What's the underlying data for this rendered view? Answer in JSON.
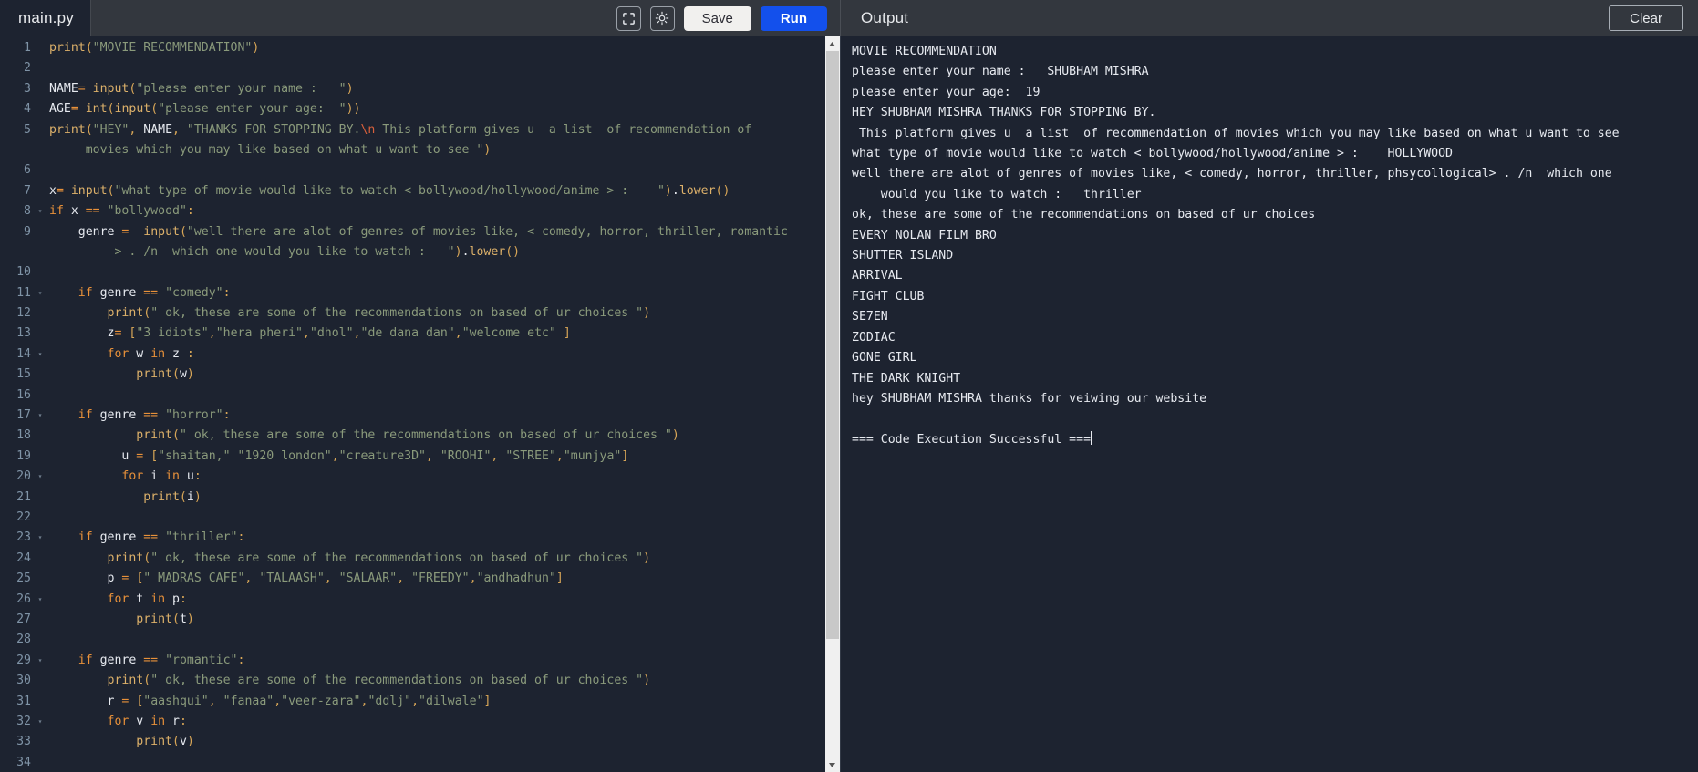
{
  "editor_toolbar": {
    "filename": "main.py",
    "fullscreen_icon": "fullscreen-icon",
    "theme_icon": "brightness-sun-icon",
    "save_label": "Save",
    "run_label": "Run",
    "save_bg": "#f1f0ee",
    "run_bg": "#1350ec"
  },
  "output_header": {
    "title": "Output",
    "clear_label": "Clear"
  },
  "editor": {
    "language": "python",
    "lines": [
      {
        "num": "1",
        "fold": "",
        "segs": [
          {
            "t": "print",
            "c": "fn"
          },
          {
            "t": "(",
            "c": "punc"
          },
          {
            "t": "\"MOVIE RECOMMENDATION\"",
            "c": "str"
          },
          {
            "t": ")",
            "c": "punc"
          }
        ]
      },
      {
        "num": "2",
        "fold": "",
        "segs": []
      },
      {
        "num": "3",
        "fold": "",
        "segs": [
          {
            "t": "NAME",
            "c": "var"
          },
          {
            "t": "= ",
            "c": "op"
          },
          {
            "t": "input",
            "c": "fn"
          },
          {
            "t": "(",
            "c": "punc"
          },
          {
            "t": "\"please enter your name :   \"",
            "c": "str"
          },
          {
            "t": ")",
            "c": "punc"
          }
        ]
      },
      {
        "num": "4",
        "fold": "",
        "segs": [
          {
            "t": "AGE",
            "c": "var"
          },
          {
            "t": "= ",
            "c": "op"
          },
          {
            "t": "int",
            "c": "fn"
          },
          {
            "t": "(",
            "c": "punc"
          },
          {
            "t": "input",
            "c": "fn"
          },
          {
            "t": "(",
            "c": "punc"
          },
          {
            "t": "\"please enter your age:  \"",
            "c": "str"
          },
          {
            "t": "))",
            "c": "punc"
          }
        ]
      },
      {
        "num": "5",
        "fold": "",
        "segs": [
          {
            "t": "print",
            "c": "fn"
          },
          {
            "t": "(",
            "c": "punc"
          },
          {
            "t": "\"HEY\"",
            "c": "str"
          },
          {
            "t": ", ",
            "c": "punc"
          },
          {
            "t": "NAME",
            "c": "var"
          },
          {
            "t": ", ",
            "c": "punc"
          },
          {
            "t": "\"THANKS FOR STOPPING BY.",
            "c": "str"
          },
          {
            "t": "\\n",
            "c": "esc"
          },
          {
            "t": " This platform gives u  a list  of recommendation of",
            "c": "str"
          }
        ]
      },
      {
        "num": "",
        "fold": "",
        "segs": [
          {
            "t": "     movies which you may like based on what u want to see \"",
            "c": "str"
          },
          {
            "t": ")",
            "c": "punc"
          }
        ]
      },
      {
        "num": "6",
        "fold": "",
        "segs": []
      },
      {
        "num": "7",
        "fold": "",
        "segs": [
          {
            "t": "x",
            "c": "var"
          },
          {
            "t": "= ",
            "c": "op"
          },
          {
            "t": "input",
            "c": "fn"
          },
          {
            "t": "(",
            "c": "punc"
          },
          {
            "t": "\"what type of movie would like to watch < bollywood/hollywood/anime > :    \"",
            "c": "str"
          },
          {
            "t": ")",
            "c": "punc"
          },
          {
            "t": ".",
            "c": "var"
          },
          {
            "t": "lower",
            "c": "fn"
          },
          {
            "t": "()",
            "c": "punc"
          }
        ]
      },
      {
        "num": "8",
        "fold": "v",
        "segs": [
          {
            "t": "if ",
            "c": "kw"
          },
          {
            "t": "x ",
            "c": "var"
          },
          {
            "t": "== ",
            "c": "op"
          },
          {
            "t": "\"bollywood\"",
            "c": "str"
          },
          {
            "t": ":",
            "c": "punc"
          }
        ]
      },
      {
        "num": "9",
        "fold": "",
        "segs": [
          {
            "t": "    ",
            "c": "var"
          },
          {
            "t": "genre ",
            "c": "var"
          },
          {
            "t": "= ",
            "c": "op"
          },
          {
            "t": " ",
            "c": "var"
          },
          {
            "t": "input",
            "c": "fn"
          },
          {
            "t": "(",
            "c": "punc"
          },
          {
            "t": "\"well there are alot of genres of movies like, < comedy, horror, thriller, romantic",
            "c": "str"
          }
        ]
      },
      {
        "num": "",
        "fold": "",
        "segs": [
          {
            "t": "         > . /n  which one would you like to watch :   \"",
            "c": "str"
          },
          {
            "t": ")",
            "c": "punc"
          },
          {
            "t": ".",
            "c": "var"
          },
          {
            "t": "lower",
            "c": "fn"
          },
          {
            "t": "()",
            "c": "punc"
          }
        ]
      },
      {
        "num": "10",
        "fold": "",
        "segs": []
      },
      {
        "num": "11",
        "fold": "v",
        "segs": [
          {
            "t": "    ",
            "c": "var"
          },
          {
            "t": "if ",
            "c": "kw"
          },
          {
            "t": "genre ",
            "c": "var"
          },
          {
            "t": "== ",
            "c": "op"
          },
          {
            "t": "\"comedy\"",
            "c": "str"
          },
          {
            "t": ":",
            "c": "punc"
          }
        ]
      },
      {
        "num": "12",
        "fold": "",
        "segs": [
          {
            "t": "        ",
            "c": "var"
          },
          {
            "t": "print",
            "c": "fn"
          },
          {
            "t": "(",
            "c": "punc"
          },
          {
            "t": "\" ok, these are some of the recommendations on based of ur choices \"",
            "c": "str"
          },
          {
            "t": ")",
            "c": "punc"
          }
        ]
      },
      {
        "num": "13",
        "fold": "",
        "segs": [
          {
            "t": "        ",
            "c": "var"
          },
          {
            "t": "z",
            "c": "var"
          },
          {
            "t": "= ",
            "c": "op"
          },
          {
            "t": "[",
            "c": "punc"
          },
          {
            "t": "\"3 idiots\"",
            "c": "str"
          },
          {
            "t": ",",
            "c": "punc"
          },
          {
            "t": "\"hera pheri\"",
            "c": "str"
          },
          {
            "t": ",",
            "c": "punc"
          },
          {
            "t": "\"dhol\"",
            "c": "str"
          },
          {
            "t": ",",
            "c": "punc"
          },
          {
            "t": "\"de dana dan\"",
            "c": "str"
          },
          {
            "t": ",",
            "c": "punc"
          },
          {
            "t": "\"welcome etc\"",
            "c": "str"
          },
          {
            "t": " ]",
            "c": "punc"
          }
        ]
      },
      {
        "num": "14",
        "fold": "v",
        "segs": [
          {
            "t": "        ",
            "c": "var"
          },
          {
            "t": "for ",
            "c": "kw"
          },
          {
            "t": "w ",
            "c": "var"
          },
          {
            "t": "in ",
            "c": "kw"
          },
          {
            "t": "z ",
            "c": "var"
          },
          {
            "t": ":",
            "c": "punc"
          }
        ]
      },
      {
        "num": "15",
        "fold": "",
        "segs": [
          {
            "t": "            ",
            "c": "var"
          },
          {
            "t": "print",
            "c": "fn"
          },
          {
            "t": "(",
            "c": "punc"
          },
          {
            "t": "w",
            "c": "var"
          },
          {
            "t": ")",
            "c": "punc"
          }
        ]
      },
      {
        "num": "16",
        "fold": "",
        "segs": []
      },
      {
        "num": "17",
        "fold": "v",
        "segs": [
          {
            "t": "    ",
            "c": "var"
          },
          {
            "t": "if ",
            "c": "kw"
          },
          {
            "t": "genre ",
            "c": "var"
          },
          {
            "t": "== ",
            "c": "op"
          },
          {
            "t": "\"horror\"",
            "c": "str"
          },
          {
            "t": ":",
            "c": "punc"
          }
        ]
      },
      {
        "num": "18",
        "fold": "",
        "segs": [
          {
            "t": "            ",
            "c": "var"
          },
          {
            "t": "print",
            "c": "fn"
          },
          {
            "t": "(",
            "c": "punc"
          },
          {
            "t": "\" ok, these are some of the recommendations on based of ur choices \"",
            "c": "str"
          },
          {
            "t": ")",
            "c": "punc"
          }
        ]
      },
      {
        "num": "19",
        "fold": "",
        "segs": [
          {
            "t": "          ",
            "c": "var"
          },
          {
            "t": "u ",
            "c": "var"
          },
          {
            "t": "= ",
            "c": "op"
          },
          {
            "t": "[",
            "c": "punc"
          },
          {
            "t": "\"shaitan,\"",
            "c": "str"
          },
          {
            "t": " ",
            "c": "var"
          },
          {
            "t": "\"1920 london\"",
            "c": "str"
          },
          {
            "t": ",",
            "c": "punc"
          },
          {
            "t": "\"creature3D\"",
            "c": "str"
          },
          {
            "t": ", ",
            "c": "punc"
          },
          {
            "t": "\"ROOHI\"",
            "c": "str"
          },
          {
            "t": ", ",
            "c": "punc"
          },
          {
            "t": "\"STREE\"",
            "c": "str"
          },
          {
            "t": ",",
            "c": "punc"
          },
          {
            "t": "\"munjya\"",
            "c": "str"
          },
          {
            "t": "]",
            "c": "punc"
          }
        ]
      },
      {
        "num": "20",
        "fold": "v",
        "segs": [
          {
            "t": "          ",
            "c": "var"
          },
          {
            "t": "for ",
            "c": "kw"
          },
          {
            "t": "i ",
            "c": "var"
          },
          {
            "t": "in ",
            "c": "kw"
          },
          {
            "t": "u",
            "c": "var"
          },
          {
            "t": ":",
            "c": "punc"
          }
        ]
      },
      {
        "num": "21",
        "fold": "",
        "segs": [
          {
            "t": "             ",
            "c": "var"
          },
          {
            "t": "print",
            "c": "fn"
          },
          {
            "t": "(",
            "c": "punc"
          },
          {
            "t": "i",
            "c": "var"
          },
          {
            "t": ")",
            "c": "punc"
          }
        ]
      },
      {
        "num": "22",
        "fold": "",
        "segs": []
      },
      {
        "num": "23",
        "fold": "v",
        "segs": [
          {
            "t": "    ",
            "c": "var"
          },
          {
            "t": "if ",
            "c": "kw"
          },
          {
            "t": "genre ",
            "c": "var"
          },
          {
            "t": "== ",
            "c": "op"
          },
          {
            "t": "\"thriller\"",
            "c": "str"
          },
          {
            "t": ":",
            "c": "punc"
          }
        ]
      },
      {
        "num": "24",
        "fold": "",
        "segs": [
          {
            "t": "        ",
            "c": "var"
          },
          {
            "t": "print",
            "c": "fn"
          },
          {
            "t": "(",
            "c": "punc"
          },
          {
            "t": "\" ok, these are some of the recommendations on based of ur choices \"",
            "c": "str"
          },
          {
            "t": ")",
            "c": "punc"
          }
        ]
      },
      {
        "num": "25",
        "fold": "",
        "segs": [
          {
            "t": "        ",
            "c": "var"
          },
          {
            "t": "p ",
            "c": "var"
          },
          {
            "t": "= ",
            "c": "op"
          },
          {
            "t": "[",
            "c": "punc"
          },
          {
            "t": "\" MADRAS CAFE\"",
            "c": "str"
          },
          {
            "t": ", ",
            "c": "punc"
          },
          {
            "t": "\"TALAASH\"",
            "c": "str"
          },
          {
            "t": ", ",
            "c": "punc"
          },
          {
            "t": "\"SALAAR\"",
            "c": "str"
          },
          {
            "t": ", ",
            "c": "punc"
          },
          {
            "t": "\"FREEDY\"",
            "c": "str"
          },
          {
            "t": ",",
            "c": "punc"
          },
          {
            "t": "\"andhadhun\"",
            "c": "str"
          },
          {
            "t": "]",
            "c": "punc"
          }
        ]
      },
      {
        "num": "26",
        "fold": "v",
        "segs": [
          {
            "t": "        ",
            "c": "var"
          },
          {
            "t": "for ",
            "c": "kw"
          },
          {
            "t": "t ",
            "c": "var"
          },
          {
            "t": "in ",
            "c": "kw"
          },
          {
            "t": "p",
            "c": "var"
          },
          {
            "t": ":",
            "c": "punc"
          }
        ]
      },
      {
        "num": "27",
        "fold": "",
        "segs": [
          {
            "t": "            ",
            "c": "var"
          },
          {
            "t": "print",
            "c": "fn"
          },
          {
            "t": "(",
            "c": "punc"
          },
          {
            "t": "t",
            "c": "var"
          },
          {
            "t": ")",
            "c": "punc"
          }
        ]
      },
      {
        "num": "28",
        "fold": "",
        "segs": []
      },
      {
        "num": "29",
        "fold": "v",
        "segs": [
          {
            "t": "    ",
            "c": "var"
          },
          {
            "t": "if ",
            "c": "kw"
          },
          {
            "t": "genre ",
            "c": "var"
          },
          {
            "t": "== ",
            "c": "op"
          },
          {
            "t": "\"romantic\"",
            "c": "str"
          },
          {
            "t": ":",
            "c": "punc"
          }
        ]
      },
      {
        "num": "30",
        "fold": "",
        "segs": [
          {
            "t": "        ",
            "c": "var"
          },
          {
            "t": "print",
            "c": "fn"
          },
          {
            "t": "(",
            "c": "punc"
          },
          {
            "t": "\" ok, these are some of the recommendations on based of ur choices \"",
            "c": "str"
          },
          {
            "t": ")",
            "c": "punc"
          }
        ]
      },
      {
        "num": "31",
        "fold": "",
        "segs": [
          {
            "t": "        ",
            "c": "var"
          },
          {
            "t": "r ",
            "c": "var"
          },
          {
            "t": "= ",
            "c": "op"
          },
          {
            "t": "[",
            "c": "punc"
          },
          {
            "t": "\"aashqui\"",
            "c": "str"
          },
          {
            "t": ", ",
            "c": "punc"
          },
          {
            "t": "\"fanaa\"",
            "c": "str"
          },
          {
            "t": ",",
            "c": "punc"
          },
          {
            "t": "\"veer-zara\"",
            "c": "str"
          },
          {
            "t": ",",
            "c": "punc"
          },
          {
            "t": "\"ddlj\"",
            "c": "str"
          },
          {
            "t": ",",
            "c": "punc"
          },
          {
            "t": "\"dilwale\"",
            "c": "str"
          },
          {
            "t": "]",
            "c": "punc"
          }
        ]
      },
      {
        "num": "32",
        "fold": "v",
        "segs": [
          {
            "t": "        ",
            "c": "var"
          },
          {
            "t": "for ",
            "c": "kw"
          },
          {
            "t": "v ",
            "c": "var"
          },
          {
            "t": "in ",
            "c": "kw"
          },
          {
            "t": "r",
            "c": "var"
          },
          {
            "t": ":",
            "c": "punc"
          }
        ]
      },
      {
        "num": "33",
        "fold": "",
        "segs": [
          {
            "t": "            ",
            "c": "var"
          },
          {
            "t": "print",
            "c": "fn"
          },
          {
            "t": "(",
            "c": "punc"
          },
          {
            "t": "v",
            "c": "var"
          },
          {
            "t": ")",
            "c": "punc"
          }
        ]
      },
      {
        "num": "34",
        "fold": "",
        "segs": []
      }
    ]
  },
  "output": {
    "lines": [
      "MOVIE RECOMMENDATION",
      "please enter your name :   SHUBHAM MISHRA",
      "please enter your age:  19",
      "HEY SHUBHAM MISHRA THANKS FOR STOPPING BY.",
      " This platform gives u  a list  of recommendation of movies which you may like based on what u want to see",
      "what type of movie would like to watch < bollywood/hollywood/anime > :    HOLLYWOOD",
      "well there are alot of genres of movies like, < comedy, horror, thriller, phsycollogical> . /n  which one",
      "    would you like to watch :   thriller",
      "ok, these are some of the recommendations on based of ur choices",
      "EVERY NOLAN FILM BRO",
      "SHUTTER ISLAND",
      "ARRIVAL",
      "FIGHT CLUB",
      "SE7EN",
      "ZODIAC",
      "GONE GIRL",
      "THE DARK KNIGHT",
      "hey SHUBHAM MISHRA thanks for veiwing our website",
      ""
    ],
    "status_line": "=== Code Execution Successful ===",
    "has_caret": true
  },
  "scrollbar": {
    "up_arrow_icon": "chevron-up-icon",
    "down_arrow_icon": "chevron-down-icon"
  }
}
